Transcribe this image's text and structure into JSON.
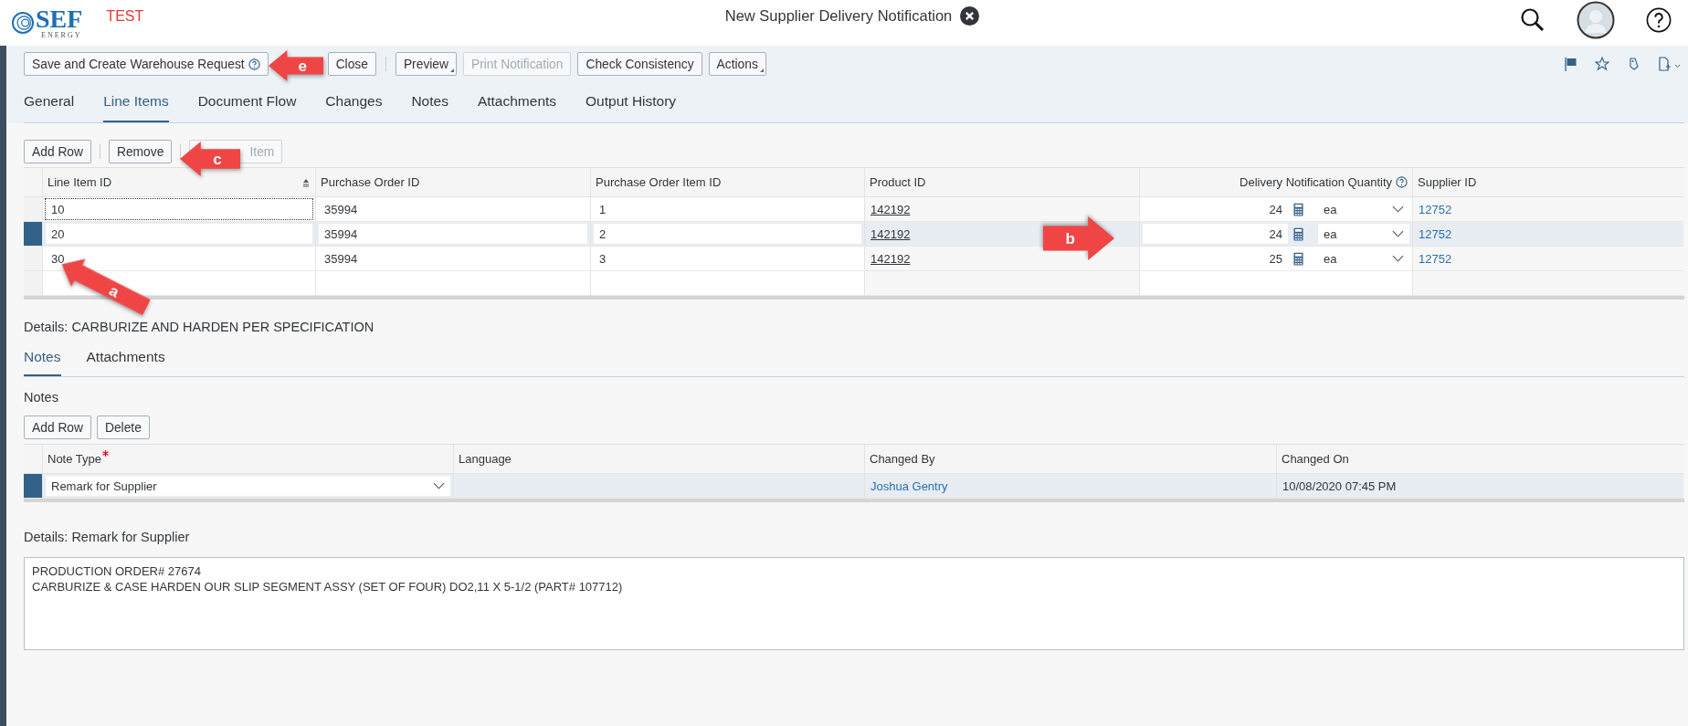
{
  "header": {
    "logo": {
      "name": "SEF",
      "tagline": "ENERGY"
    },
    "environment": "TEST",
    "title": "New Supplier Delivery Notification"
  },
  "toolbar": {
    "groups": [
      [
        {
          "label": "Save and Create Warehouse Request",
          "help": true,
          "menu": false,
          "disabled": false
        },
        {
          "label": "Close",
          "help": false,
          "menu": false,
          "disabled": false
        }
      ],
      [
        {
          "label": "Preview",
          "help": false,
          "menu": true,
          "disabled": false
        },
        {
          "label": "Print Notification",
          "help": false,
          "menu": false,
          "disabled": true
        },
        {
          "label": "Check Consistency",
          "help": false,
          "menu": false,
          "disabled": false
        },
        {
          "label": "Actions",
          "help": false,
          "menu": true,
          "disabled": false
        }
      ]
    ]
  },
  "tabs": [
    {
      "label": "General",
      "selected": false
    },
    {
      "label": "Line Items",
      "selected": true
    },
    {
      "label": "Document Flow",
      "selected": false
    },
    {
      "label": "Changes",
      "selected": false
    },
    {
      "label": "Notes",
      "selected": false
    },
    {
      "label": "Attachments",
      "selected": false
    },
    {
      "label": "Output History",
      "selected": false
    }
  ],
  "line_items": {
    "buttons": [
      {
        "label": "Add Row",
        "disabled": false
      },
      {
        "label": "Remove",
        "disabled": false
      },
      {
        "label": "Item",
        "disabled": true
      }
    ],
    "columns": [
      {
        "label": "Line Item ID",
        "sorted": true,
        "help": false
      },
      {
        "label": "Purchase Order ID",
        "sorted": false,
        "help": false
      },
      {
        "label": "Purchase Order Item ID",
        "sorted": false,
        "help": false
      },
      {
        "label": "Product ID",
        "sorted": false,
        "help": false
      },
      {
        "label": "Delivery Notification Quantity",
        "sorted": false,
        "help": true
      },
      {
        "label": "Supplier ID",
        "sorted": false,
        "help": false
      }
    ],
    "rows": [
      {
        "selected": false,
        "line_item_id": "10",
        "purchase_order_id": "35994",
        "purchase_order_item_id": "1",
        "product_id": "142192",
        "quantity": "24",
        "unit": "ea",
        "supplier_id": "12752"
      },
      {
        "selected": true,
        "line_item_id": "20",
        "purchase_order_id": "35994",
        "purchase_order_item_id": "2",
        "product_id": "142192",
        "quantity": "24",
        "unit": "ea",
        "supplier_id": "12752"
      },
      {
        "selected": false,
        "line_item_id": "30",
        "purchase_order_id": "35994",
        "purchase_order_item_id": "3",
        "product_id": "142192",
        "quantity": "25",
        "unit": "ea",
        "supplier_id": "12752"
      }
    ]
  },
  "details_title": "Details: CARBURIZE AND HARDEN PER SPECIFICATION",
  "detail_tabs": [
    {
      "label": "Notes",
      "selected": true
    },
    {
      "label": "Attachments",
      "selected": false
    }
  ],
  "notes": {
    "title": "Notes",
    "buttons": [
      {
        "label": "Add Row",
        "disabled": false
      },
      {
        "label": "Delete",
        "disabled": false
      }
    ],
    "columns": [
      {
        "label": "Note Type",
        "required": true
      },
      {
        "label": "Language",
        "required": false
      },
      {
        "label": "Changed By",
        "required": false
      },
      {
        "label": "Changed On",
        "required": false
      }
    ],
    "rows": [
      {
        "selected": true,
        "note_type": "Remark for Supplier",
        "changed_by": "Joshua Gentry",
        "changed_on": "10/08/2020 07:45 PM"
      }
    ]
  },
  "remark": {
    "title": "Details: Remark for Supplier",
    "lines": [
      "PRODUCTION ORDER# 27674",
      "CARBURIZE & CASE HARDEN OUR SLIP SEGMENT ASSY (SET OF FOUR) DO2,11 X 5-1/2 (PART# 107712)"
    ]
  },
  "callouts": [
    {
      "label": "e",
      "kind": "left"
    },
    {
      "label": "c",
      "kind": "left"
    },
    {
      "label": "a",
      "kind": "up-left"
    },
    {
      "label": "b",
      "kind": "right"
    }
  ]
}
